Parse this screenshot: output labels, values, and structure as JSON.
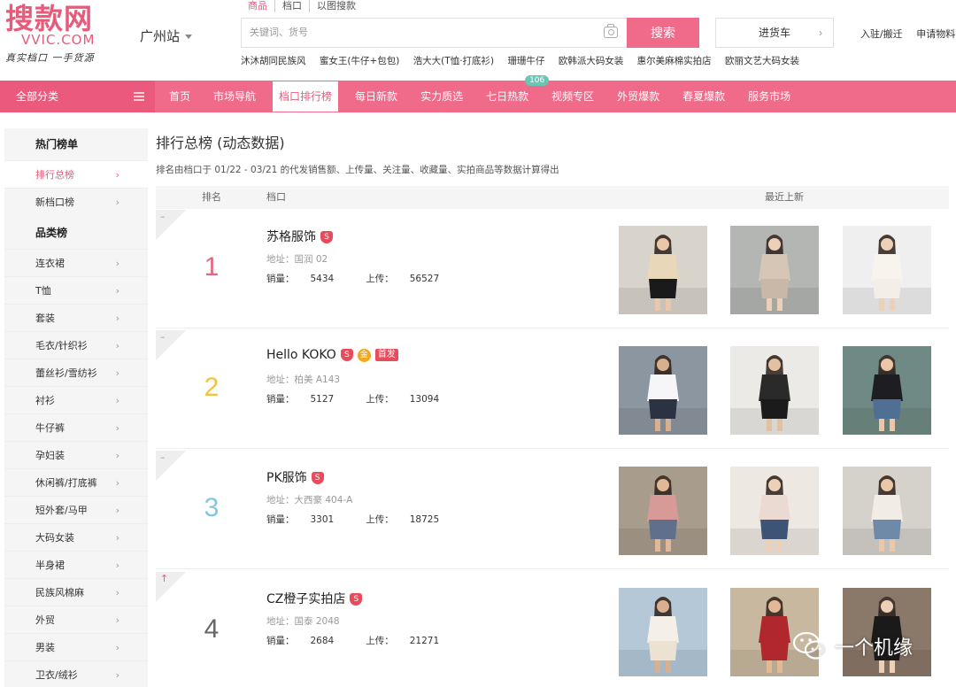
{
  "header": {
    "logo_cn": "搜款网",
    "logo_en": "VVIC.COM",
    "logo_slogan": "真实档口 一手货源",
    "station": "广州站",
    "search_tabs": [
      "商品",
      "档口",
      "以图搜款"
    ],
    "search_placeholder": "关键词、货号",
    "search_button": "搜索",
    "cart_button": "进货车",
    "top_links": [
      "入驻/搬迁",
      "申请物料"
    ],
    "hot_words": [
      "沐沐胡同民族风",
      "蜜女王(牛仔+包包)",
      "浩大大(T恤·打底衫)",
      "珊珊牛仔",
      "欧韩派大码女装",
      "惠尔美麻棉实拍店",
      "欧丽文艺大码女装"
    ]
  },
  "nav": {
    "all_categories": "全部分类",
    "items": [
      {
        "label": "首页",
        "active": false
      },
      {
        "label": "市场导航",
        "active": false
      },
      {
        "label": "档口排行榜",
        "active": true
      },
      {
        "label": "每日新款",
        "active": false
      },
      {
        "label": "实力质选",
        "active": false
      },
      {
        "label": "七日热款",
        "active": false,
        "badge": "106"
      },
      {
        "label": "视频专区",
        "active": false
      },
      {
        "label": "外贸爆款",
        "active": false
      },
      {
        "label": "春夏爆款",
        "active": false
      },
      {
        "label": "服务市场",
        "active": false
      }
    ]
  },
  "sidebar": {
    "hot_title": "热门榜单",
    "hot_items": [
      {
        "label": "排行总榜",
        "active": true
      },
      {
        "label": "新档口榜",
        "active": false
      }
    ],
    "category_title": "品类榜",
    "category_items": [
      "连衣裙",
      "T恤",
      "套装",
      "毛衣/针织衫",
      "蕾丝衫/雪纺衫",
      "衬衫",
      "牛仔裤",
      "孕妇装",
      "休闲裤/打底裤",
      "短外套/马甲",
      "大码女装",
      "半身裙",
      "民族风棉麻",
      "外贸",
      "男装",
      "卫衣/绒衫"
    ]
  },
  "main": {
    "title": "排行总榜 (动态数据)",
    "desc": "排名由档口于 01/22 - 03/21 的代发销售额、上传量、关注量、收藏量、实拍商品等数据计算得出",
    "columns": {
      "rank": "排名",
      "shop": "档口",
      "recent": "最近上新"
    },
    "address_prefix": "地址：",
    "sales_prefix": "销量：",
    "upload_prefix": "上传：",
    "rows": [
      {
        "rank": "1",
        "rank_color": "#e8647e",
        "trend": "–",
        "name": "苏格服饰",
        "badges": [
          "S"
        ],
        "address": "国润 02",
        "sales": "5434",
        "uploads": "56527"
      },
      {
        "rank": "2",
        "rank_color": "#f2c43c",
        "trend": "–",
        "name": "Hello KOKO",
        "badges": [
          "S",
          "金",
          "首发"
        ],
        "address": "柏美 A143",
        "sales": "5127",
        "uploads": "13094"
      },
      {
        "rank": "3",
        "rank_color": "#7fc6e4",
        "trend": "–",
        "name": "PK服饰",
        "badges": [
          "S"
        ],
        "address": "大西豪 404-A",
        "sales": "3301",
        "uploads": "18725"
      },
      {
        "rank": "4",
        "rank_color": "#666666",
        "trend": "↑",
        "name": "CZ橙子实拍店",
        "badges": [
          "S"
        ],
        "address": "国泰 2048",
        "sales": "2684",
        "uploads": "21271"
      }
    ]
  },
  "watermark": "一个机缘",
  "colors": {
    "brand": "#f06a8a",
    "brand_dark": "#eb5a7c",
    "badge_red": "#e84c5c"
  }
}
